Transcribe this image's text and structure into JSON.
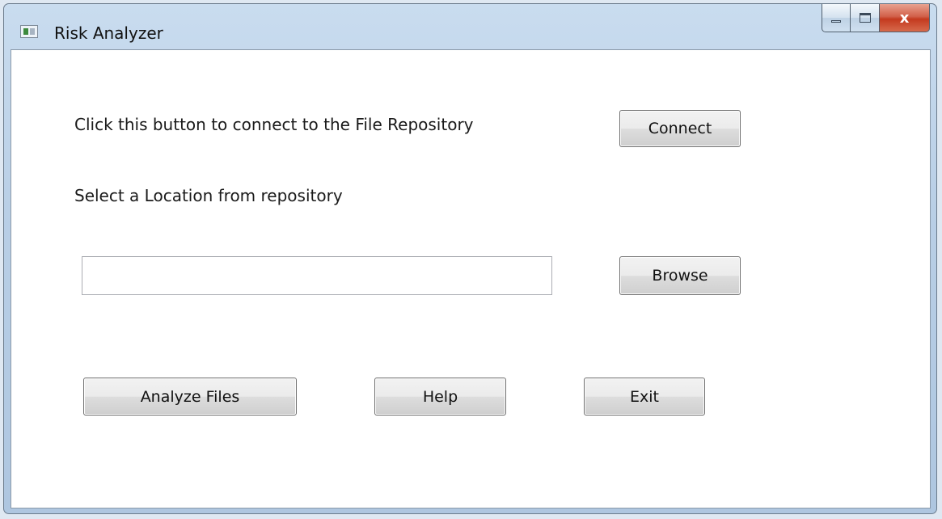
{
  "window": {
    "title": "Risk Analyzer",
    "caption_close": "x"
  },
  "main": {
    "connect_prompt": "Click this button to connect to the File Repository",
    "connect_button": "Connect",
    "location_prompt": "Select a Location from repository",
    "location_input": {
      "value": "",
      "placeholder": ""
    },
    "browse_button": "Browse",
    "analyze_button": "Analyze Files",
    "help_button": "Help",
    "exit_button": "Exit"
  }
}
